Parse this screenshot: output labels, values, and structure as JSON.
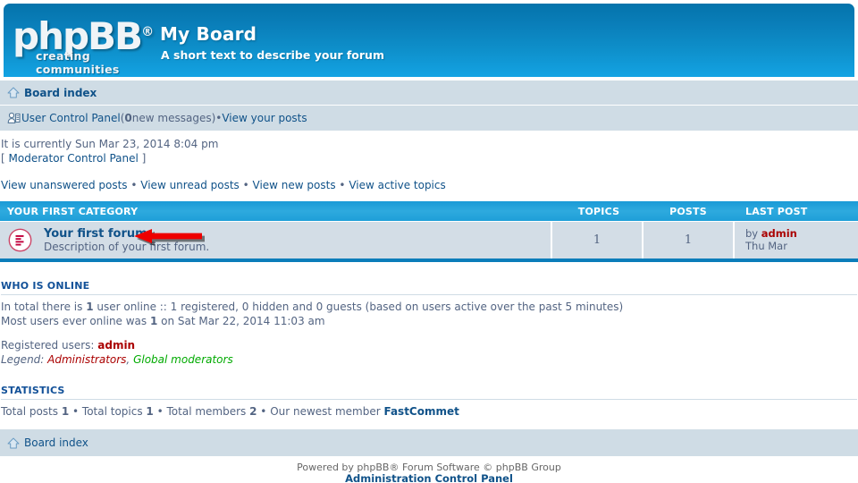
{
  "header": {
    "logo_main": "phpBB",
    "logo_registered": "®",
    "logo_tagline": "creating communities",
    "site_title": "My Board",
    "site_description": "A short text to describe your forum"
  },
  "navbar": {
    "board_index": "Board index",
    "home_icon": "home-icon",
    "ucp_icon": "user-control-panel-icon",
    "ucp_label": "User Control Panel",
    "ucp_open_paren": "(",
    "ucp_new_count": "0",
    "ucp_new_messages": " new messages",
    "ucp_close_paren": ")",
    "bullet": " • ",
    "view_your_posts": "View your posts"
  },
  "info": {
    "current_time": "It is currently Sun Mar 23, 2014 8:04 pm",
    "mcp_open": "[ ",
    "mcp_label": "Moderator Control Panel",
    "mcp_close": " ]"
  },
  "quick_links": {
    "items": [
      "View unanswered posts",
      "View unread posts",
      "View new posts",
      "View active topics"
    ],
    "separator": " • "
  },
  "forum_table": {
    "category_title": "YOUR FIRST CATEGORY",
    "col_topics": "TOPICS",
    "col_posts": "POSTS",
    "col_lastpost": "LAST POST",
    "rows": [
      {
        "icon": "forum-unread-icon",
        "name": "Your first forum",
        "description": "Description of your first forum.",
        "topics": "1",
        "posts": "1",
        "lastpost_by_prefix": "by ",
        "lastpost_author": "admin",
        "lastpost_date": "Thu Mar"
      }
    ]
  },
  "annotation": {
    "arrow": "red-left-arrow",
    "color": "#ee0000"
  },
  "who_is_online": {
    "title": "WHO IS ONLINE",
    "line1_a": "In total there is ",
    "line1_count": "1",
    "line1_b": " user online :: 1 registered, 0 hidden and 0 guests (based on users active over the past 5 minutes)",
    "line2_a": "Most users ever online was ",
    "line2_count": "1",
    "line2_b": " on Sat Mar 22, 2014 11:03 am",
    "registered_label": "Registered users: ",
    "registered_users": "admin",
    "legend_label": "Legend: ",
    "legend_admins": "Administrators",
    "legend_comma": ", ",
    "legend_gmods": "Global moderators"
  },
  "statistics": {
    "title": "STATISTICS",
    "total_posts_label": "Total posts ",
    "total_posts": "1",
    "bullet": " • ",
    "total_topics_label": "Total topics ",
    "total_topics": "1",
    "total_members_label": "Total members ",
    "total_members": "2",
    "newest_member_label": "Our newest member ",
    "newest_member": "FastCommet"
  },
  "footer": {
    "board_index": "Board index",
    "home_icon": "home-icon",
    "powered_by": "Powered by phpBB® Forum Software © phpBB Group",
    "acp_link": "Administration Control Panel"
  },
  "colors": {
    "header_top": "#0473ab",
    "header_bottom": "#13a3e3",
    "nav_bg": "#cfdce5",
    "category_bar": "#2eaade",
    "row_bg": "#d3dde6",
    "link": "#105289",
    "text": "#536482",
    "admin_red": "#aa0000",
    "gmod_green": "#00aa00",
    "arrow_red": "#ee0000"
  }
}
